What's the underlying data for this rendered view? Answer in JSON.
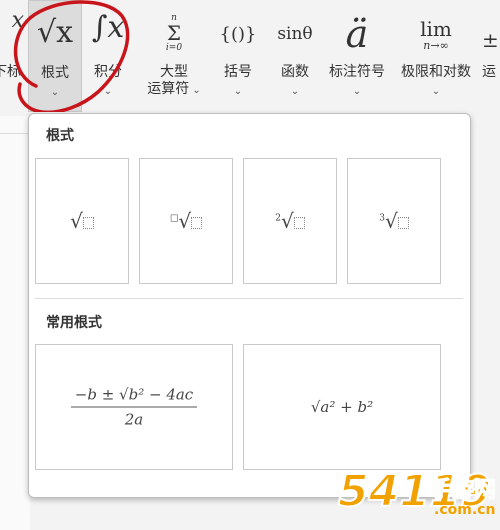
{
  "ribbon": {
    "items": [
      {
        "label": "下标",
        "symbol": "x"
      },
      {
        "label": "根式",
        "symbol": "√x"
      },
      {
        "label": "积分",
        "symbol": "∫x"
      },
      {
        "label": "大型\n运算符",
        "label_line1": "大型",
        "label_line2": "运算符",
        "symbol_top": "n",
        "symbol": "Σ",
        "symbol_bottom": "i=0"
      },
      {
        "label": "括号",
        "symbol": "{()}"
      },
      {
        "label": "函数",
        "symbol": "sinθ"
      },
      {
        "label": "标注符号",
        "symbol": "ä"
      },
      {
        "label": "极限和对数",
        "symbol": "lim",
        "symbol_sub": "n→∞"
      },
      {
        "label": "运",
        "symbol": "±"
      }
    ]
  },
  "panel": {
    "section1_title": "根式",
    "section2_title": "常用根式",
    "radical_tiles": [
      {
        "name": "square-root",
        "index": ""
      },
      {
        "name": "nth-root",
        "index": "□"
      },
      {
        "name": "square-root-with-degree",
        "index": "2"
      },
      {
        "name": "cube-root",
        "index": "3"
      }
    ],
    "common_tiles": [
      {
        "numerator": "−b ± √b² − 4ac",
        "denominator": "2a"
      },
      {
        "expression": "√a² + b²"
      }
    ]
  },
  "watermark": {
    "number": "54119",
    "chinese": "手游网",
    "domain": ".com.cn"
  }
}
